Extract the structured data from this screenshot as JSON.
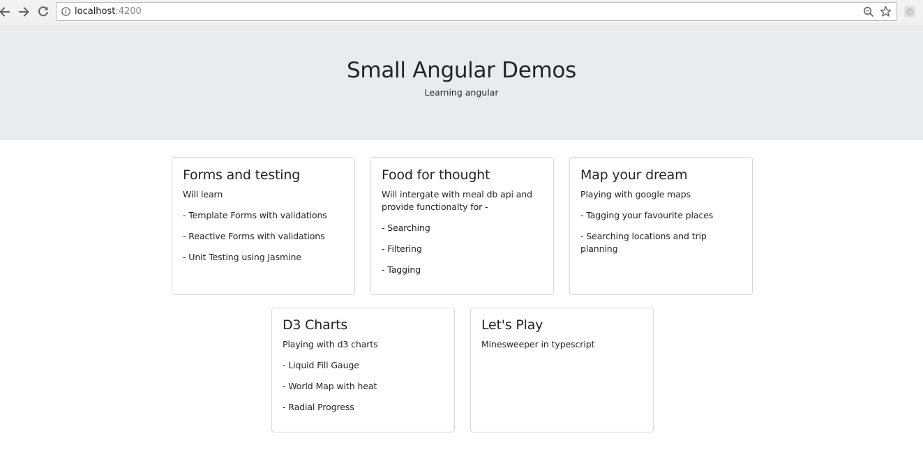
{
  "browser": {
    "url_host": "localhost",
    "url_port": ":4200",
    "icons": {
      "back": "arrow-left-icon",
      "forward": "arrow-right-icon",
      "reload": "reload-icon",
      "info": "info-icon",
      "zoom": "zoom-icon",
      "bookmark": "star-icon",
      "extension": "extension-icon"
    }
  },
  "header": {
    "title": "Small Angular Demos",
    "subtitle": "Learning angular",
    "background": "#e9ecef"
  },
  "cards": [
    {
      "title": "Forms and testing",
      "intro": "Will learn",
      "items": [
        "- Template Forms with validations",
        "- Reactive Forms with validations",
        "- Unit Testing using Jasmine"
      ]
    },
    {
      "title": "Food for thought",
      "intro": "Will intergate with meal db api and provide functionalty for -",
      "items": [
        "- Searching",
        "- Filtering",
        "- Tagging"
      ]
    },
    {
      "title": "Map your dream",
      "intro": "Playing with google maps",
      "items": [
        "- Tagging your favourite places",
        "- Searching locations and trip planning"
      ]
    },
    {
      "title": "D3 Charts",
      "intro": "Playing with d3 charts",
      "items": [
        "- Liquid Fill Gauge",
        "- World Map with heat",
        "- Radial Progress"
      ]
    },
    {
      "title": "Let's Play",
      "intro": "Minesweeper in typescript",
      "items": []
    }
  ]
}
